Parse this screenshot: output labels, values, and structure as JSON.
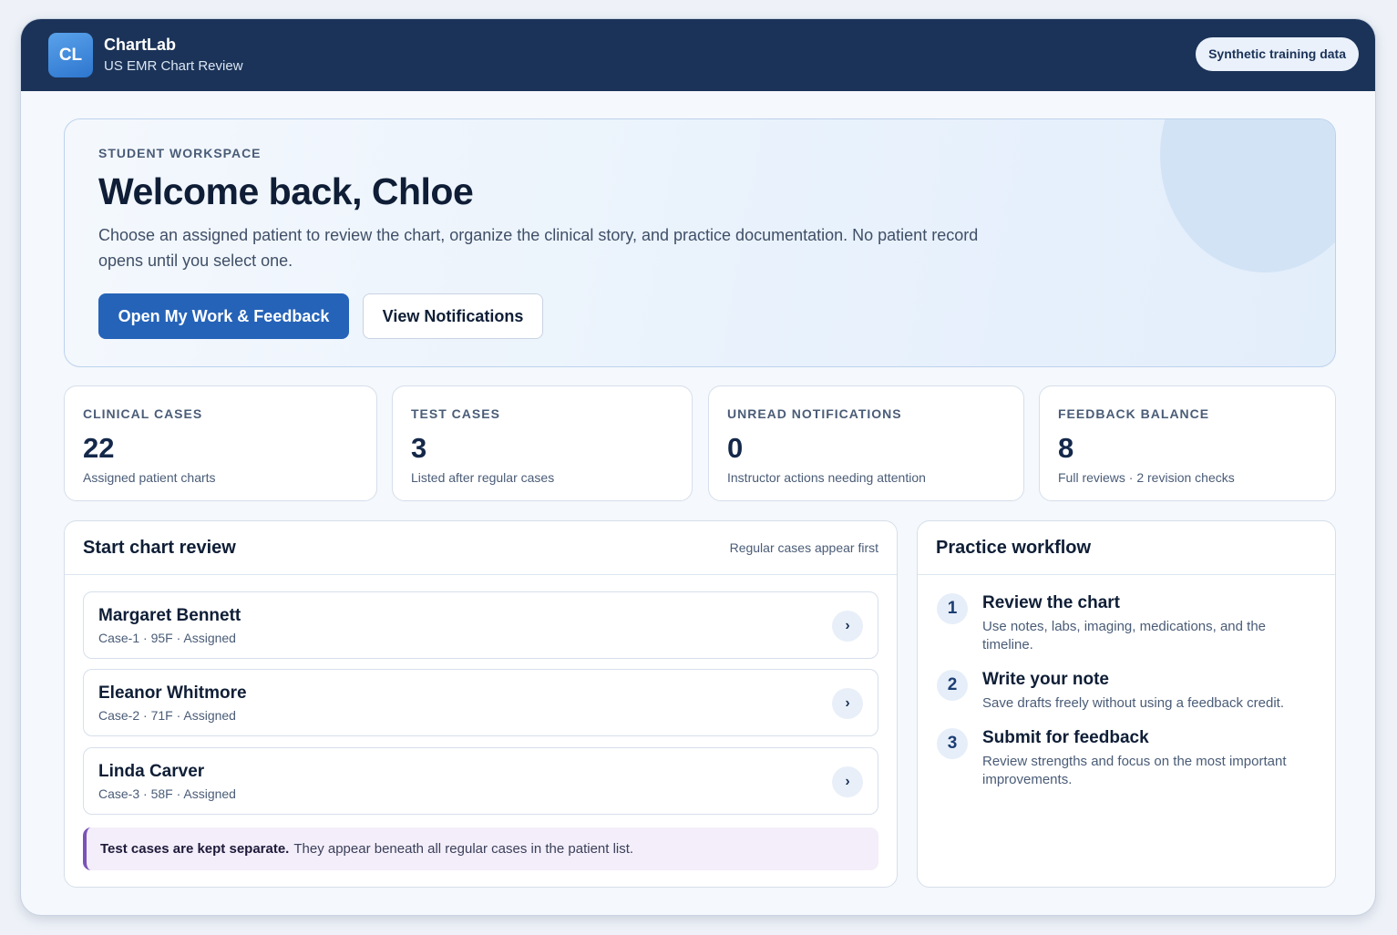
{
  "app": {
    "logo_text": "CL",
    "name": "ChartLab",
    "subtitle": "US EMR Chart Review",
    "badge": "Synthetic training data"
  },
  "hero": {
    "eyebrow": "STUDENT WORKSPACE",
    "title": "Welcome back, Chloe",
    "description": "Choose an assigned patient to review the chart, organize the clinical story, and practice documentation. No patient record opens until you select one.",
    "primary_button": "Open My Work & Feedback",
    "secondary_button": "View Notifications"
  },
  "stats": [
    {
      "label": "CLINICAL CASES",
      "value": "22",
      "desc": "Assigned patient charts"
    },
    {
      "label": "TEST CASES",
      "value": "3",
      "desc": "Listed after regular cases"
    },
    {
      "label": "UNREAD NOTIFICATIONS",
      "value": "0",
      "desc": "Instructor actions needing attention"
    },
    {
      "label": "FEEDBACK BALANCE",
      "value": "8",
      "desc": "Full reviews · 2 revision checks"
    }
  ],
  "chart_review": {
    "title": "Start chart review",
    "hint": "Regular cases appear first",
    "cases": [
      {
        "name": "Margaret Bennett",
        "meta": "Case-1 · 95F · Assigned"
      },
      {
        "name": "Eleanor Whitmore",
        "meta": "Case-2 · 71F · Assigned"
      },
      {
        "name": "Linda Carver",
        "meta": "Case-3 · 58F · Assigned"
      }
    ],
    "chevron": "›",
    "notice_strong": "Test cases are kept separate.",
    "notice_text": "They appear beneath all regular cases in the patient list."
  },
  "workflow": {
    "title": "Practice workflow",
    "steps": [
      {
        "num": "1",
        "title": "Review the chart",
        "desc": "Use notes, labs, imaging, medications, and the timeline."
      },
      {
        "num": "2",
        "title": "Write your note",
        "desc": "Save drafts freely without using a feedback credit."
      },
      {
        "num": "3",
        "title": "Submit for feedback",
        "desc": "Review strengths and focus on the most important improvements."
      }
    ]
  }
}
